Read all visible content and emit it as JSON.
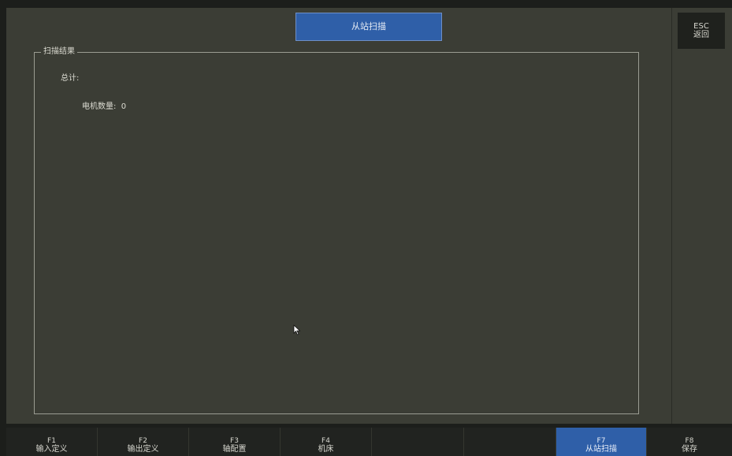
{
  "title": "从站扫描",
  "esc": {
    "key": "ESC",
    "label": "返回"
  },
  "scan_result": {
    "legend": "扫描结果",
    "total_label": "总计:",
    "motor_count_label": "电机数量:",
    "motor_count_value": "0"
  },
  "fkeys": [
    {
      "key": "F1",
      "label": "输入定义",
      "active": false
    },
    {
      "key": "F2",
      "label": "输出定义",
      "active": false
    },
    {
      "key": "F3",
      "label": "轴配置",
      "active": false
    },
    {
      "key": "F4",
      "label": "机床",
      "active": false
    },
    {
      "key": "",
      "label": "",
      "active": false
    },
    {
      "key": "",
      "label": "",
      "active": false
    },
    {
      "key": "F7",
      "label": "从站扫描",
      "active": true
    },
    {
      "key": "F8",
      "label": "保存",
      "active": false
    }
  ],
  "colors": {
    "active_accent": "#2f5fa8",
    "panel_background": "#3b3d35",
    "frame_background": "#1c1e1b"
  }
}
